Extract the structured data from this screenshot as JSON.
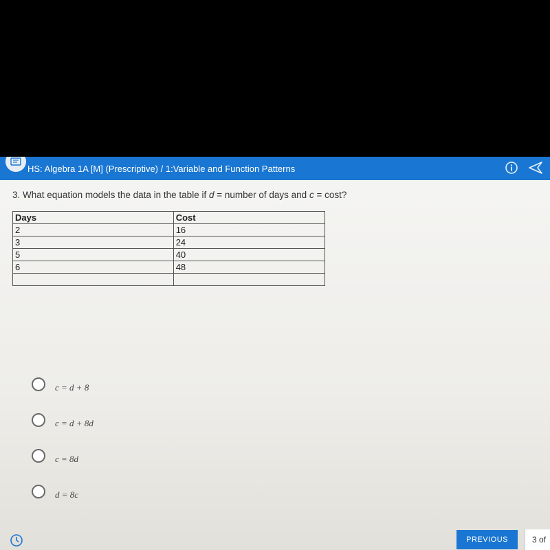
{
  "header": {
    "title": "HS: Algebra 1A [M] (Prescriptive) / 1:Variable and Function Patterns"
  },
  "question": {
    "number": "3.",
    "prefix": "What equation models the data in the table if ",
    "var1": "d",
    "mid1": " = number of days and ",
    "var2": "c",
    "suffix": " = cost?"
  },
  "table": {
    "col0": "Days",
    "col1": "Cost",
    "rows": [
      {
        "d": "2",
        "c": "16"
      },
      {
        "d": "3",
        "c": "24"
      },
      {
        "d": "5",
        "c": "40"
      },
      {
        "d": "6",
        "c": "48"
      }
    ]
  },
  "options": {
    "a": "c = d + 8",
    "b": "c = d + 8d",
    "c": "c = 8d",
    "d": "d = 8c"
  },
  "nav": {
    "previous": "PREVIOUS",
    "page": "3 of"
  },
  "chart_data": {
    "type": "table",
    "columns": [
      "Days",
      "Cost"
    ],
    "rows": [
      [
        2,
        16
      ],
      [
        3,
        24
      ],
      [
        5,
        40
      ],
      [
        6,
        48
      ]
    ]
  }
}
